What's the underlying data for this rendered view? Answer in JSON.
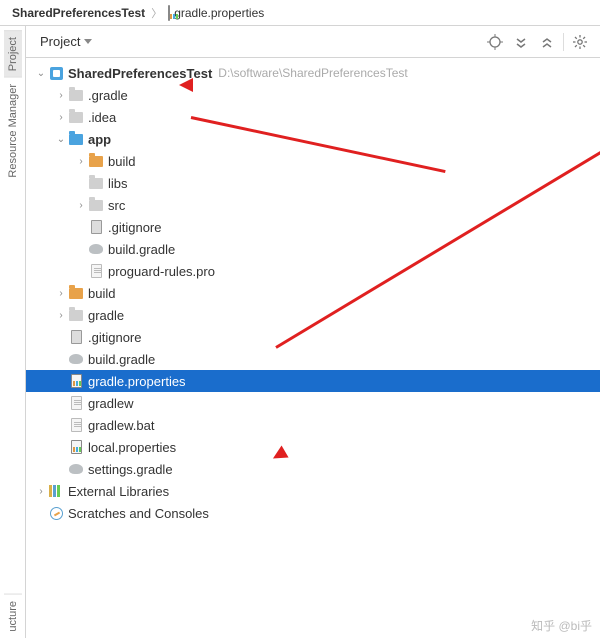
{
  "breadcrumb": {
    "project": "SharedPreferencesTest",
    "file": "gradle.properties"
  },
  "sidebar": {
    "tabs": [
      {
        "label": "Project"
      },
      {
        "label": "Resource Manager"
      },
      {
        "label": "ucture"
      }
    ]
  },
  "toolbar": {
    "view_label": "Project"
  },
  "tree": [
    {
      "arrow": "v",
      "indent": 0,
      "icon": "module",
      "label": "SharedPreferencesTest",
      "bold": true,
      "path": "D:\\software\\SharedPreferencesTest"
    },
    {
      "arrow": ">",
      "indent": 1,
      "icon": "folder-gray",
      "label": ".gradle"
    },
    {
      "arrow": ">",
      "indent": 1,
      "icon": "folder-gray",
      "label": ".idea"
    },
    {
      "arrow": "v",
      "indent": 1,
      "icon": "folder-blue",
      "label": "app",
      "bold": true
    },
    {
      "arrow": ">",
      "indent": 2,
      "icon": "folder-orange",
      "label": "build"
    },
    {
      "arrow": " ",
      "indent": 2,
      "icon": "folder-gray",
      "label": "libs"
    },
    {
      "arrow": ">",
      "indent": 2,
      "icon": "folder-gray",
      "label": "src"
    },
    {
      "arrow": " ",
      "indent": 2,
      "icon": "file-dark",
      "label": ".gitignore"
    },
    {
      "arrow": " ",
      "indent": 2,
      "icon": "gradle",
      "label": "build.gradle"
    },
    {
      "arrow": " ",
      "indent": 2,
      "icon": "file-txt",
      "label": "proguard-rules.pro"
    },
    {
      "arrow": ">",
      "indent": 1,
      "icon": "folder-orange",
      "label": "build"
    },
    {
      "arrow": ">",
      "indent": 1,
      "icon": "folder-gray",
      "label": "gradle"
    },
    {
      "arrow": " ",
      "indent": 1,
      "icon": "file-dark",
      "label": ".gitignore"
    },
    {
      "arrow": " ",
      "indent": 1,
      "icon": "gradle",
      "label": "build.gradle"
    },
    {
      "arrow": " ",
      "indent": 1,
      "icon": "file-props",
      "label": "gradle.properties",
      "selected": true
    },
    {
      "arrow": " ",
      "indent": 1,
      "icon": "file-txt",
      "label": "gradlew"
    },
    {
      "arrow": " ",
      "indent": 1,
      "icon": "file-txt",
      "label": "gradlew.bat"
    },
    {
      "arrow": " ",
      "indent": 1,
      "icon": "file-props",
      "label": "local.properties"
    },
    {
      "arrow": " ",
      "indent": 1,
      "icon": "gradle",
      "label": "settings.gradle"
    },
    {
      "arrow": ">",
      "indent": 0,
      "icon": "lib",
      "label": "External Libraries"
    },
    {
      "arrow": " ",
      "indent": 0,
      "icon": "scratch",
      "label": "Scratches and Consoles"
    }
  ],
  "watermark": "知乎 @bi乎"
}
